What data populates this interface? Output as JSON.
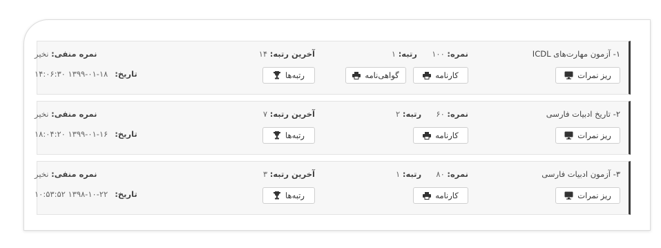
{
  "exams": [
    {
      "title": "۱- آزمون مهارت‌های ICDL",
      "score_label": "نمره:",
      "score_value": "۱۰۰",
      "rank_label": "رتبه:",
      "rank_value": "۱",
      "last_rank_label": "آخرین رتبه:",
      "last_rank_value": "۱۴",
      "negative_label": "نمره منفی:",
      "negative_value": "نخیر",
      "date_label": "تاریخ:",
      "date_value": "۱۳۹۹-۰۱-۱۸ ۱۴:۰۶:۳۰",
      "buttons": {
        "details": "ریز نمرات",
        "report": "کارنامه",
        "certificate": "گواهی‌نامه",
        "ranks": "رتبه‌ها"
      }
    },
    {
      "title": "۲- تاریخ ادبیات فارسی",
      "score_label": "نمره:",
      "score_value": "۶۰",
      "rank_label": "رتبه:",
      "rank_value": "۲",
      "last_rank_label": "آخرین رتبه:",
      "last_rank_value": "۷",
      "negative_label": "نمره منفی:",
      "negative_value": "نخیر",
      "date_label": "تاریخ:",
      "date_value": "۱۳۹۹-۰۱-۱۶ ۱۸:۰۴:۲۰",
      "buttons": {
        "details": "ریز نمرات",
        "report": "کارنامه",
        "ranks": "رتبه‌ها"
      }
    },
    {
      "title": "۳- آزمون ادبیات فارسی",
      "score_label": "نمره:",
      "score_value": "۸۰",
      "rank_label": "رتبه:",
      "rank_value": "۱",
      "last_rank_label": "آخرین رتبه:",
      "last_rank_value": "۳",
      "negative_label": "نمره منفی:",
      "negative_value": "نخیر",
      "date_label": "تاریخ:",
      "date_value": "۱۳۹۸-۱۰-۲۲ ۱۰:۵۳:۵۲",
      "buttons": {
        "details": "ریز نمرات",
        "report": "کارنامه",
        "ranks": "رتبه‌ها"
      }
    }
  ],
  "icons": {
    "details": "monitor-icon",
    "report": "printer-icon",
    "certificate": "printer-icon",
    "ranks": "trophy-icon"
  },
  "colors": {
    "card_bg": "#f7f7f7",
    "card_accent": "#3a3a3a",
    "button_border": "#cfcfcf"
  }
}
